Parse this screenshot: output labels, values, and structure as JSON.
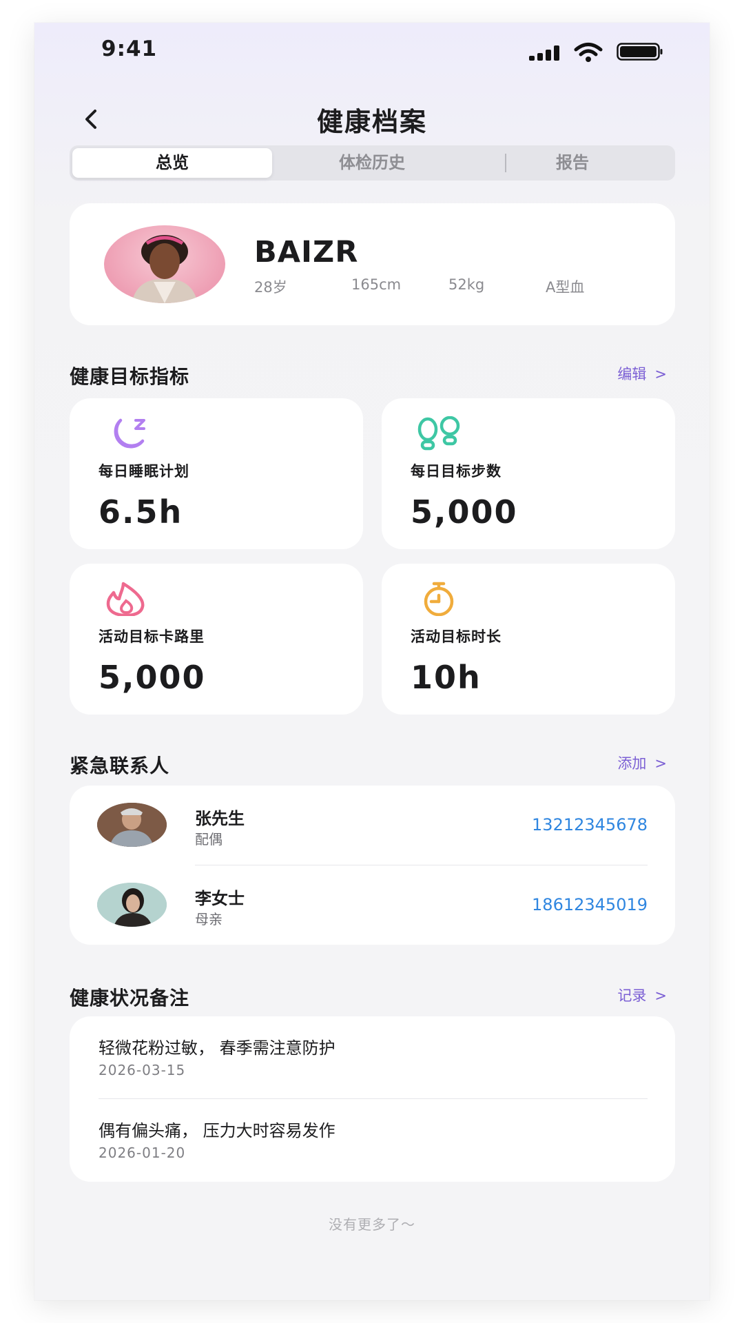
{
  "status_bar": {
    "time": "9:41"
  },
  "header": {
    "title": "健康档案"
  },
  "tabs": [
    {
      "label": "总览",
      "active": true
    },
    {
      "label": "体检历史",
      "active": false
    },
    {
      "label": "报告",
      "active": false
    }
  ],
  "profile": {
    "name": "BAIZR",
    "age": "28岁",
    "height": "165cm",
    "weight": "52kg",
    "blood_type": "A型血"
  },
  "goals_section": {
    "title": "健康目标指标",
    "link": "编辑",
    "items": [
      {
        "icon": "moon-sleep-icon",
        "label": "每日睡眠计划",
        "value": "6.5h",
        "color": "#b27ff0"
      },
      {
        "icon": "footprints-icon",
        "label": "每日目标步数",
        "value": "5,000",
        "color": "#3ec7a4"
      },
      {
        "icon": "flame-icon",
        "label": "活动目标卡路里",
        "value": "5,000",
        "color": "#ee6a8f"
      },
      {
        "icon": "stopwatch-icon",
        "label": "活动目标时长",
        "value": "10h",
        "color": "#f0ac3c"
      }
    ]
  },
  "contacts_section": {
    "title": "紧急联系人",
    "link": "添加",
    "items": [
      {
        "name": "张先生",
        "relation": "配偶",
        "phone": "13212345678"
      },
      {
        "name": "李女士",
        "relation": "母亲",
        "phone": "18612345019"
      }
    ]
  },
  "notes_section": {
    "title": "健康状况备注",
    "link": "记录",
    "items": [
      {
        "text": "轻微花粉过敏， 春季需注意防护",
        "date": "2026-03-15"
      },
      {
        "text": "偶有偏头痛， 压力大时容易发作",
        "date": "2026-01-20"
      }
    ]
  },
  "footer": {
    "text": "没有更多了～"
  },
  "colors": {
    "accent": "#7b5fd4",
    "phone_link": "#2f86e0"
  }
}
